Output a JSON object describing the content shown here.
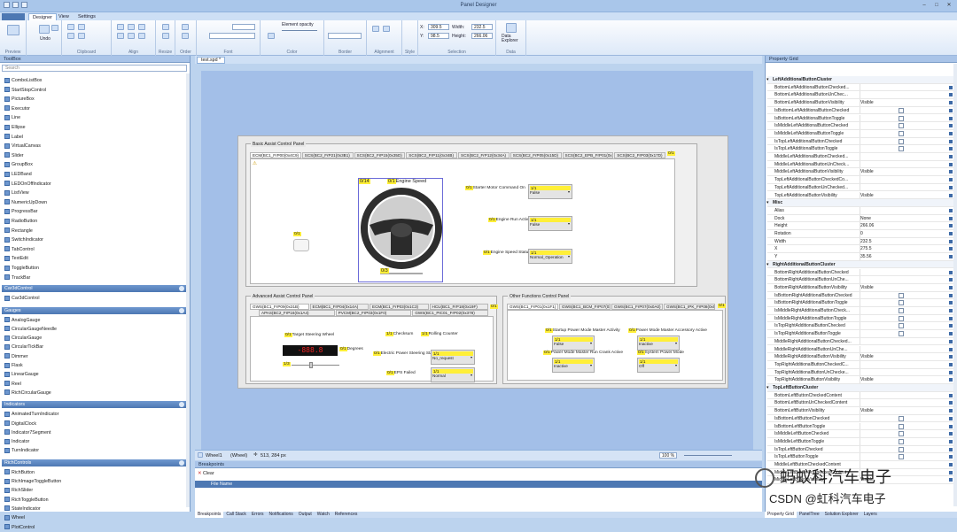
{
  "window": {
    "title": "Panel Designer"
  },
  "ribbon": {
    "tabs": [
      "Designer",
      "View",
      "Settings"
    ],
    "active_tab": "Designer",
    "groups": [
      "Preview",
      "Undo",
      "Clipboard",
      "Align",
      "Resize",
      "Order",
      "Font",
      "Color",
      "Border",
      "Alignment",
      "Style",
      "Selection",
      "Data"
    ],
    "undo_label": "Undo",
    "element_opacity_label": "Element opacity",
    "x_label": "X:",
    "x_value": "309.5",
    "y_label": "Y:",
    "y_value": "98.5",
    "width_label": "Width:",
    "width_value": "232.5",
    "height_label": "Height:",
    "height_value": "266.06",
    "data_explorer_label": "Data Explorer"
  },
  "toolbox": {
    "title": "ToolBox",
    "search_placeholder": "Search",
    "items_top": [
      "ComboListBox",
      "StartStopControl",
      "PictureBox",
      "Executor",
      "Line",
      "Ellipse",
      "Label",
      "VirtualCanvas",
      "Slider",
      "GroupBox",
      "LEDBand",
      "LEDOnOffIndicator",
      "ListView",
      "NumericUpDown",
      "ProgressBar",
      "RadioButton",
      "Rectangle",
      "SwitchIndicator",
      "TabControl",
      "TextEdit",
      "ToggleButton",
      "TrackBar"
    ],
    "categories": [
      {
        "name": "Car3dControl",
        "items": [
          "Car3dControl"
        ]
      },
      {
        "name": "Gauges",
        "items": [
          "AnalogGauge",
          "CircularGaugeNeedle",
          "CircularGauge",
          "CircularTickBar",
          "Dimmer",
          "Flask",
          "LinearGauge",
          "Reel",
          "RichCircularGauge"
        ]
      },
      {
        "name": "Indicators",
        "items": [
          "AnimatedTurnIndicator",
          "DigitalClock",
          "Indicator7Segment",
          "Indicator",
          "TurnIndicator"
        ]
      },
      {
        "name": "RichControls",
        "items": [
          "RichButton",
          "RichImageToggleButton",
          "RichSlider",
          "RichToggleButton",
          "StateIndicator",
          "Wheel",
          "PlotControl"
        ]
      }
    ]
  },
  "document": {
    "tab": "test.spd *",
    "basic_panel": {
      "title": "Basic Assist Control Panel",
      "tabs": [
        "ECM(BC1_FrP00(0x4C9)",
        "SCS(BC2_FrP21(0x3B1)",
        "SCS(BC2_FrP15(0x35D)",
        "SCS(BC2_FrP11(0x34B)",
        "SCS(BC2_FrP12(0x34A)",
        "SCS(BC2_FrP05(0x15D)",
        "SCS(BC2_EPB_FrP01(0x22A)",
        "SCS(BC2_FrP03(0x17D)"
      ],
      "page_count": "0/1",
      "steering_label": "Engine Speed",
      "steering_top_tag": "0/14",
      "tag_left": "0/1",
      "tag_bottom": "0/3",
      "starter": {
        "tag": "0/1",
        "label": "Starter Motor Command On",
        "dd_tag": "1/1",
        "value": "False"
      },
      "engine_run": {
        "tag": "0/1",
        "label": "Engine Run Active",
        "dd_tag": "1/1",
        "value": "False"
      },
      "engine_speed": {
        "tag": "0/1",
        "label": "Engine Speed Status",
        "dd_tag": "1/1",
        "value": "Normal_Operation"
      }
    },
    "advanced_panel": {
      "title": "Advanced Assist Control Panel",
      "tabs_row1": [
        "GWS(BC1_FrP09(0x31B)",
        "ECM(BC1_FrP04(0x14A)",
        "ECM(BC1_FrP03(0x1C3)",
        "HCU(BC1_FrP18(0x19F)"
      ],
      "tabs_row2": [
        "APAS(BC2_FrP16(0x1A4)",
        "PVCM(BC2_FrP03(0x1F0)",
        "GWS(BC1_PIC01_FrP02(0x378)"
      ],
      "page_count": "0/1",
      "target_wheel": {
        "tag": "0/1",
        "label": "Target Steering Wheel",
        "unit": "Degrees",
        "unit_tag": "0/1"
      },
      "slider_tag": "1/3",
      "checksum": {
        "tag": "1/1",
        "label": "Checksum"
      },
      "rolling": {
        "tag": "1/1",
        "label": "Rolling Counter"
      },
      "eps_status": {
        "tag": "0/1",
        "label": "Electric Power Steering Status",
        "dd_tag": "1/1",
        "value": "No_request"
      },
      "eps_failed": {
        "tag": "0/1",
        "label": "EPS Failed",
        "dd_tag": "1/1",
        "value": "Normal"
      }
    },
    "other_panel": {
      "title": "Other Functions Control Panel",
      "tabs": [
        "GWS(BC1_FrP01(0x1F1)",
        "GWS(BC1_BCM_FrP07(0x1F2)",
        "GWS(BC1_FrP07(0x0A0)",
        "GWS(BC1_IPK_FrP08(0x541)"
      ],
      "page_count": "0/1",
      "startup_master": {
        "tag": "0/1",
        "label": "Startup Power Mode Master Activity",
        "dd_tag": "1/1",
        "value": "False"
      },
      "accessory": {
        "tag": "0/1",
        "label": "Power Mode Master Accessory Active",
        "dd_tag": "1/1",
        "value": "Inactive"
      },
      "crank": {
        "tag": "0/1",
        "label": "Power Mode Master Run Crank Active",
        "dd_tag": "1/1",
        "value": "Inactive"
      },
      "system_power": {
        "tag": "0/1",
        "label": "System Power Mode",
        "dd_tag": "1/1",
        "value": "Off"
      }
    }
  },
  "status_bar": {
    "element": "Wheel1",
    "element_type": "(Wheel)",
    "position": "513, 284 px",
    "zoom": "100 %"
  },
  "breakpoints": {
    "title": "Breakpoints",
    "clear_label": "Clear",
    "column": "File Name"
  },
  "bottom_tabs": [
    "Breakpoints",
    "Call Stack",
    "Errors",
    "Notifications",
    "Output",
    "Watch",
    "References"
  ],
  "right_bottom_tabs": [
    "Property Grid",
    "PanelTree",
    "Solution Explorer",
    "Layers"
  ],
  "property_grid": {
    "title": "Property Grid",
    "rows": [
      {
        "k": "LeftAdditionalButtonCluster",
        "cat": true
      },
      {
        "k": "BottomLeftAdditionalButtonChecked...",
        "v": ""
      },
      {
        "k": "BottomLeftAdditionalButtonUnChec...",
        "v": ""
      },
      {
        "k": "BottomLeftAdditionalButtonVisibility",
        "v": "Visible"
      },
      {
        "k": "IsBottomLeftAdditionalButtonChecked",
        "cb": true
      },
      {
        "k": "IsBottomLeftAdditionalButtonToggle",
        "cb": true
      },
      {
        "k": "IsMiddleLeftAdditionalButtonChecked",
        "cb": true
      },
      {
        "k": "IsMiddleLeftAdditionalButtonToggle",
        "cb": true
      },
      {
        "k": "IsTopLeftAdditionalButtonChecked",
        "cb": true
      },
      {
        "k": "IsTopLeftAdditionalButtonToggle",
        "cb": true
      },
      {
        "k": "MiddleLeftAdditionalButtonChecked...",
        "v": ""
      },
      {
        "k": "MiddleLeftAdditionalButtonUnCheck...",
        "v": ""
      },
      {
        "k": "MiddleLeftAdditionalButtonVisibility",
        "v": "Visible"
      },
      {
        "k": "TopLeftAdditionalButtonCheckedCo...",
        "v": ""
      },
      {
        "k": "TopLeftAdditionalButtonUnChecked...",
        "v": ""
      },
      {
        "k": "TopLeftAdditionalButtonVisibility",
        "v": "Visible"
      },
      {
        "k": "Misc",
        "cat": true
      },
      {
        "k": "Alias",
        "v": ""
      },
      {
        "k": "Dock",
        "v": "None"
      },
      {
        "k": "Height",
        "v": "266.06"
      },
      {
        "k": "Rotation",
        "v": "0"
      },
      {
        "k": "Width",
        "v": "232.5"
      },
      {
        "k": "X",
        "v": "275.5"
      },
      {
        "k": "Y",
        "v": "35.56"
      },
      {
        "k": "RightAdditionalButtonCluster",
        "cat": true
      },
      {
        "k": "BottomRightAdditionalButtonChecked",
        "v": ""
      },
      {
        "k": "BottomRightAdditionalButtonUnChe...",
        "v": ""
      },
      {
        "k": "BottomRightAdditionalButtonVisibility",
        "v": "Visible"
      },
      {
        "k": "IsBottomRightAdditionalButtonChecked",
        "cb": true
      },
      {
        "k": "IsBottomRightAdditionalButtonToggle",
        "cb": true
      },
      {
        "k": "IsMiddleRightAdditionalButtonCheck...",
        "cb": true
      },
      {
        "k": "IsMiddleRightAdditionalButtonToggle",
        "cb": true
      },
      {
        "k": "IsTopRightAdditionalButtonChecked",
        "cb": true
      },
      {
        "k": "IsTopRightAdditionalButtonToggle",
        "cb": true
      },
      {
        "k": "MiddleRightAdditionalButtonChecked...",
        "v": ""
      },
      {
        "k": "MiddleRightAdditionalButtonUnChe...",
        "v": ""
      },
      {
        "k": "MiddleRightAdditionalButtonVisibility",
        "v": "Visible"
      },
      {
        "k": "TopRightAdditionalButtonCheckedC...",
        "v": ""
      },
      {
        "k": "TopRightAdditionalButtonUnChecke...",
        "v": ""
      },
      {
        "k": "TopRightAdditionalButtonVisibility",
        "v": "Visible"
      },
      {
        "k": "TopLeftButtonCluster",
        "cat": true
      },
      {
        "k": "BottomLeftButtonCheckedContent",
        "v": ""
      },
      {
        "k": "BottomLeftButtonUnCheckedContent",
        "v": ""
      },
      {
        "k": "BottomLeftButtonVisibility",
        "v": "Visible"
      },
      {
        "k": "IsBottomLeftButtonChecked",
        "cb": true
      },
      {
        "k": "IsBottomLeftButtonToggle",
        "cb": true
      },
      {
        "k": "IsMiddleLeftButtonChecked",
        "cb": true
      },
      {
        "k": "IsMiddleLeftButtonToggle",
        "cb": true
      },
      {
        "k": "IsTopLeftButtonChecked",
        "cb": true
      },
      {
        "k": "IsTopLeftButtonToggle",
        "cb": true
      },
      {
        "k": "MiddleLeftButtonCheckedContent",
        "v": ""
      },
      {
        "k": "MiddleLeftButtonUnCheckedContent",
        "v": ""
      },
      {
        "k": "MiddleLeftButtonVisibility",
        "v": "Visible"
      }
    ]
  },
  "watermark": {
    "line1": "蚂蚁科汽车电子",
    "line2": "CSDN @虹科汽车电子"
  }
}
